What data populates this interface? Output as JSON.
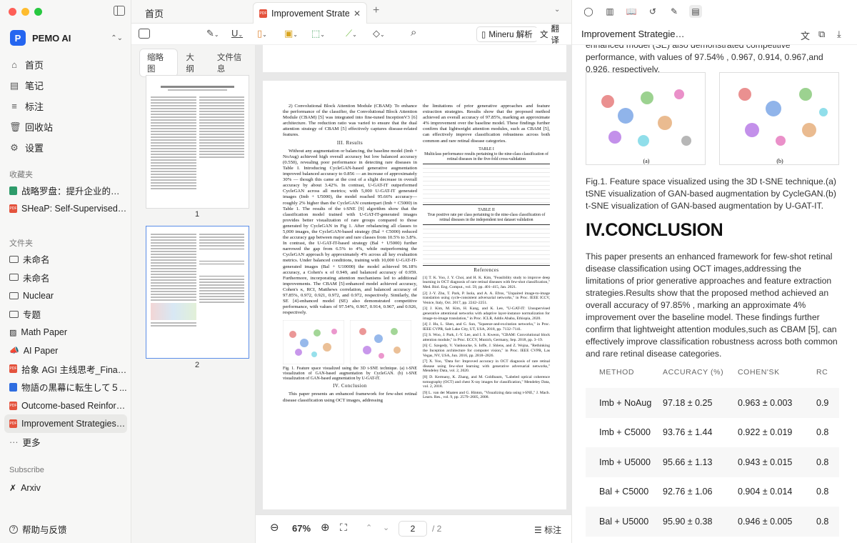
{
  "window": {
    "traffic_colors": [
      "#fe5f57",
      "#febc2e",
      "#28c840"
    ]
  },
  "sidebar": {
    "brand": "PEMO AI",
    "nav": [
      {
        "icon": "home-icon",
        "label": "首页"
      },
      {
        "icon": "notes-icon",
        "label": "笔记"
      },
      {
        "icon": "annotation-icon",
        "label": "标注"
      },
      {
        "icon": "trash-icon",
        "label": "回收站"
      },
      {
        "icon": "gear-icon",
        "label": "设置"
      }
    ],
    "favorites_title": "收藏夹",
    "favorites": [
      {
        "type": "green",
        "label": "战略罗盘：提升企业的战略..."
      },
      {
        "type": "pdf",
        "label": "SHeaP: Self-Supervised Hea..."
      }
    ],
    "files_title": "文件夹",
    "files": [
      {
        "type": "folder",
        "label": "未命名"
      },
      {
        "type": "folder",
        "label": "未命名"
      },
      {
        "type": "folder",
        "label": "Nuclear"
      },
      {
        "type": "folder",
        "label": "专题"
      },
      {
        "type": "image",
        "label": "Math Paper"
      },
      {
        "type": "megaphone",
        "label": "AI Paper"
      },
      {
        "type": "pdf",
        "label": "拾象 AGI 主线思考_Final_..."
      },
      {
        "type": "doc",
        "label": "物語の黒幕に転生して５..."
      },
      {
        "type": "pdf",
        "label": "Outcome-based Reinforcem..."
      },
      {
        "type": "pdf",
        "label": "Improvement Strategies f...",
        "active": true
      }
    ],
    "more": "更多",
    "subscribe_title": "Subscribe",
    "subscribe": [
      {
        "label": "Arxiv"
      }
    ],
    "help": "帮助与反馈"
  },
  "tabs": {
    "home": "首页",
    "active": "Improvement Strategi"
  },
  "toolbar": {
    "mineru": "Mineru 解析",
    "translate": "翻译"
  },
  "thumbs": {
    "tabs": [
      "缩略图",
      "大纲",
      "文件信息"
    ],
    "pages": [
      "1",
      "2"
    ]
  },
  "pdf": {
    "col1": {
      "p1": "2) Convolutional Block Attention Module (CBAM): To enhance the performance of the classifier, the Convolutional Block Attention Module (CBAM) [5] was integrated into fine-tuned InceptionV3 [6] architecture. The reduction ratio was varied to ensure that the dual attention strategy of CBAM [5] effectively captures disease-related features.",
      "h": "III. Results",
      "p2": "Without any augmentation or balancing, the baseline model (Imb + NoAug) achieved high overall accuracy but low balanced accuracy (0.550), revealing poor performance in detecting rare diseases in Table I. Introducing CycleGAN-based generative augmentation improved balanced accuracy to 0.856 — an increase of approximately 30% — though this came at the cost of a slight decrease in overall accuracy by about 3.42%. In contrast, U-GAT-IT outperformed CycleGAN across all metrics; with 5,000 U-GAT-IT generated images (Imb + U5000), the model reached 95.66% accuracy—roughly 2% higher than the CycleGAN counterpart (Imb + C5000) in Table 1. The results of the t-SNE [9] algorithm show that the classification model trained with U-GAT-IT-generated images provides better visualization of rare groups compared to those generated by CycleGAN in Fig 1. After rebalancing all classes to 5,000 images, the CycleGAN-based strategy (Bal + C5000) reduced the accuracy gap between major and rare classes from 10.5% to 3.8%. In contrast, the U-GAT-IT-based strategy (Bal + U5000) further narrowed the gap from 6.5% to 4%, while outperforming the CycleGAN approach by approximately 4% across all key evaluation metrics. Under balanced conditions, training with 10,000 U-GAT-IT-generated images (Bal + U10000) the model achieved 96.18% accuracy, a Cohen's κ of 0.949, and balanced accuracy of 0.959. Furthermore, incorporating attention mechanisms led to additional improvements. The CBAM [5]-enhanced model achieved accuracy, Cohen's κ, RCI, Matthews correlation, and balanced accuracy of 97.85%, 0.972, 0.921, 0.972, and 0.972, respectively. Similarly, the SE [4]-enhanced model (SE) also demonstrated competitive performance, with values of 97.54%, 0.967, 0.914, 0.967, and 0.926, respectively.",
      "cap": "Fig. 1. Feature space visualized using the 3D t-SNE technique. (a) t-SNE visualization of GAN-based augmentation by CycleGAN. (b) t-SNE visualization of GAN-based augmentation by U-GAT-IT.",
      "h2": "IV. Conclusion",
      "p3": "This paper presents an enhanced framework for few-shot retinal disease classification using OCT images, addressing"
    },
    "col2": {
      "p1": "the limitations of prior generative approaches and feature extraction strategies. Results show that the proposed method achieved an overall accuracy of 97.85%, marking an approximate 4% improvement over the baseline model. These findings further confirm that lightweight attention modules, such as CBAM [5], can effectively improve classification robustness across both common and rare retinal disease categories.",
      "t1": "TABLE I\nMulticlass performance results pertaining to the nine-class classification of retinal diseases in the five-fold cross-validation",
      "t2": "TABLE II\nTrue positive rate per class pertaining to the nine-class classification of retinal diseases in the independent test dataset validation",
      "refs_title": "References",
      "refs": [
        "[1] T. K. Yoo, J. Y. Choi, and H. K. Kim, \"Feasibility study to improve deep learning in OCT diagnosis of rare retinal diseases with few-shot classification,\" Med. Biol. Eng. Comput., vol. 59, pp. 401–415, Jan. 2021.",
        "[2] J.-Y. Zhu, T. Park, P. Isola, and A. A. Efros, \"Unpaired image-to-image translation using cycle-consistent adversarial networks,\" in Proc. IEEE ICCV, Venice, Italy, Oct. 2017, pp. 2242–2251.",
        "[3] J. Kim, M. Kim, H. Kang, and K. Lee, \"U-GAT-IT: Unsupervised generative attentional networks with adaptive layer-instance normalization for image-to-image translation,\" in Proc. ICLR, Addis Ababa, Ethiopia, 2020.",
        "[4] J. Hu, L. Shen, and G. Sun, \"Squeeze-and-excitation networks,\" in Proc. IEEE CVPR, Salt Lake City, UT, USA, 2018, pp. 7132–7141.",
        "[5] S. Woo, J. Park, J.-Y. Lee, and I. S. Kweon, \"CBAM: Convolutional block attention module,\" in Proc. ECCV, Munich, Germany, Sep. 2018, pp. 3–19.",
        "[6] C. Szegedy, V. Vanhoucke, S. Ioffe, J. Shlens, and Z. Wojna, \"Rethinking the Inception architecture for computer vision,\" in Proc. IEEE CVPR, Las Vegas, NV, USA, Jun. 2016, pp. 2818–2826.",
        "[7] X. Yoo, \"Data for: Improved accuracy in OCT diagnosis of rare retinal disease using few-shot learning with generative adversarial networks,\" Mendeley Data, vol. 2, 2020.",
        "[8] D. Kermany, K. Zhang, and M. Goldbaum, \"Labeled optical coherence tomography (OCT) and chest X-ray images for classification,\" Mendeley Data, vol. 2, 2018.",
        "[9] L. van der Maaten and G. Hinton, \"Visualizing data using t-SNE,\" J. Mach. Learn. Res., vol. 9, pp. 2579–2605, 2008."
      ]
    }
  },
  "bottombar": {
    "zoom": "67%",
    "page": "2",
    "total": "/ 2",
    "annot": "标注"
  },
  "right": {
    "title": "Improvement Strategies f...",
    "top_text": "enhanced model (SE) also demonstrated competitive performance, with values of 97.54% , 0.967, 0.914, 0.967,and 0.926, respectively.",
    "fig_labels": [
      "(a)",
      "(b)"
    ],
    "caption": "Fig.1. Feature space visualized using the 3D t-SNE technique.(a) tSNE visualization of GAN-based augmentation by CycleGAN.(b) t-SNE visualization of GAN-based augmentation by U-GAT-IT.",
    "conclusion_heading": "IV.CONCLUSION",
    "conclusion": "This paper presents an enhanced framework for few-shot retinal disease classification using OCT images,addressing the limitations of prior generative approaches and feature extraction strategies.Results show that the proposed method achieved an overall accuracy of 97.85% , marking an approximate 4% improvement over the baseline model. These findings further confirm that lightweight attention modules,such as CBAM [5], can effectively improve classification robustness across both common and rare retinal disease categories.",
    "table": {
      "headers": [
        "METHOD",
        "ACCURACY (%)",
        "COHEN'SK",
        "RC"
      ],
      "rows": [
        [
          "Imb + NoAug",
          "97.18 ± 0.25",
          "0.963 ± 0.003",
          "0.9"
        ],
        [
          "Imb + C5000",
          "93.76 ± 1.44",
          "0.922 ± 0.019",
          "0.8"
        ],
        [
          "Imb + U5000",
          "95.66 ± 1.13",
          "0.943 ± 0.015",
          "0.8"
        ],
        [
          "Bal + C5000",
          "92.76 ± 1.06",
          "0.904 ± 0.014",
          "0.8"
        ],
        [
          "Bal + U5000",
          "95.90 ± 0.38",
          "0.946 ± 0.005",
          "0.8"
        ]
      ]
    }
  }
}
